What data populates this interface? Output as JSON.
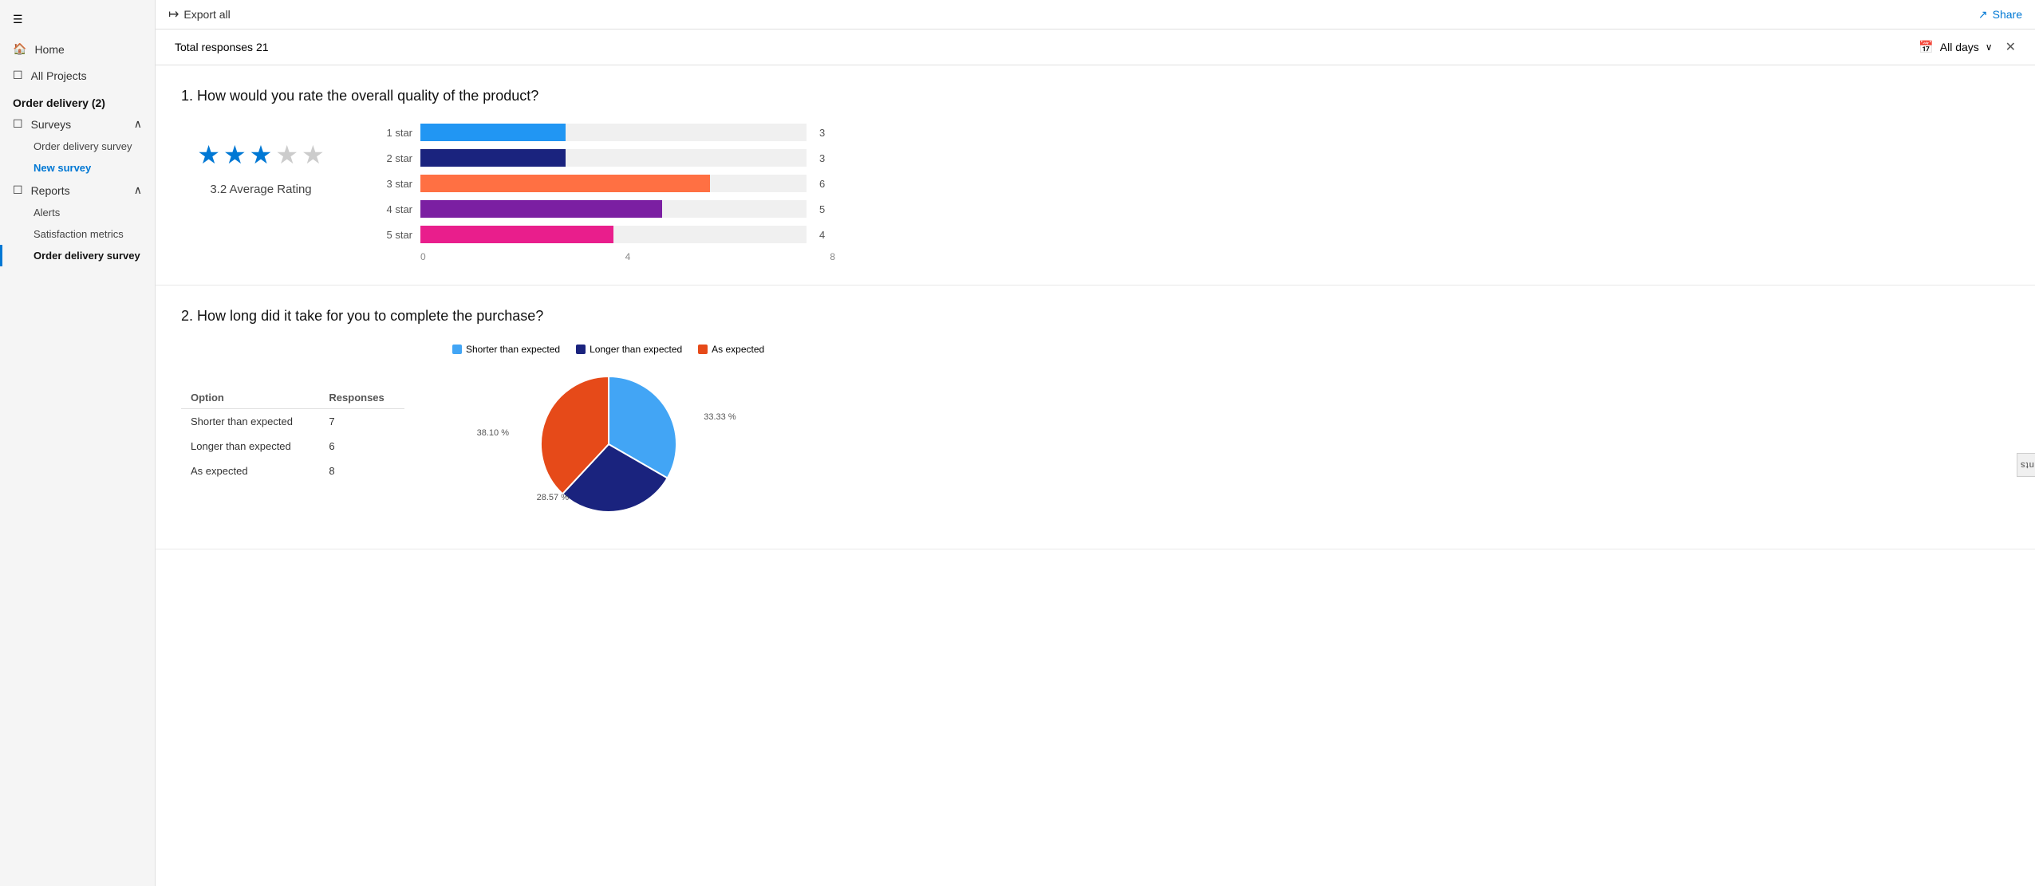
{
  "sidebar": {
    "hamburger_icon": "☰",
    "home_label": "Home",
    "all_projects_label": "All Projects",
    "section_title": "Order delivery (2)",
    "surveys_label": "Surveys",
    "survey_items": [
      {
        "label": "Order delivery survey",
        "active": false
      },
      {
        "label": "New survey",
        "active": true,
        "is_link": true
      }
    ],
    "reports_label": "Reports",
    "report_items": [
      {
        "label": "Alerts",
        "active": false
      },
      {
        "label": "Satisfaction metrics",
        "active": false
      },
      {
        "label": "Order delivery survey",
        "active": true
      }
    ]
  },
  "topbar": {
    "export_label": "Export all",
    "share_label": "Share"
  },
  "responses": {
    "total_label": "Total responses 21",
    "filter_label": "All days"
  },
  "question1": {
    "number": "1.",
    "text": "How would you rate the overall quality of the product?",
    "avg_rating": 3.2,
    "avg_label": "3.2 Average Rating",
    "stars_filled": 3,
    "stars_total": 5,
    "bars": [
      {
        "label": "1 star",
        "value": 3,
        "max": 8,
        "color": "#2196F3"
      },
      {
        "label": "2 star",
        "value": 3,
        "max": 8,
        "color": "#1A237E"
      },
      {
        "label": "3 star",
        "value": 6,
        "max": 8,
        "color": "#FF7043"
      },
      {
        "label": "4 star",
        "value": 5,
        "max": 8,
        "color": "#7B1FA2"
      },
      {
        "label": "5 star",
        "value": 4,
        "max": 8,
        "color": "#E91E8C"
      }
    ],
    "axis_labels": [
      "0",
      "4",
      "8"
    ]
  },
  "question2": {
    "number": "2.",
    "text": "How long did it take for you to complete the purchase?",
    "column_option": "Option",
    "column_responses": "Responses",
    "options": [
      {
        "label": "Shorter than expected",
        "count": 7,
        "percent": 33.33,
        "color": "#42A5F5"
      },
      {
        "label": "Longer than expected",
        "count": 6,
        "percent": 28.57,
        "color": "#1A237E"
      },
      {
        "label": "As expected",
        "count": 8,
        "percent": 38.1,
        "color": "#E64A19"
      }
    ],
    "legend": [
      {
        "label": "Shorter than expected",
        "color": "#42A5F5"
      },
      {
        "label": "Longer than expected",
        "color": "#1A237E"
      },
      {
        "label": "As expected",
        "color": "#E64A19"
      }
    ],
    "pie_labels": {
      "shorter": "33.33 %",
      "longer": "28.57 %",
      "as_expected": "38.10 %"
    }
  },
  "respondents_tab": "Respondents"
}
